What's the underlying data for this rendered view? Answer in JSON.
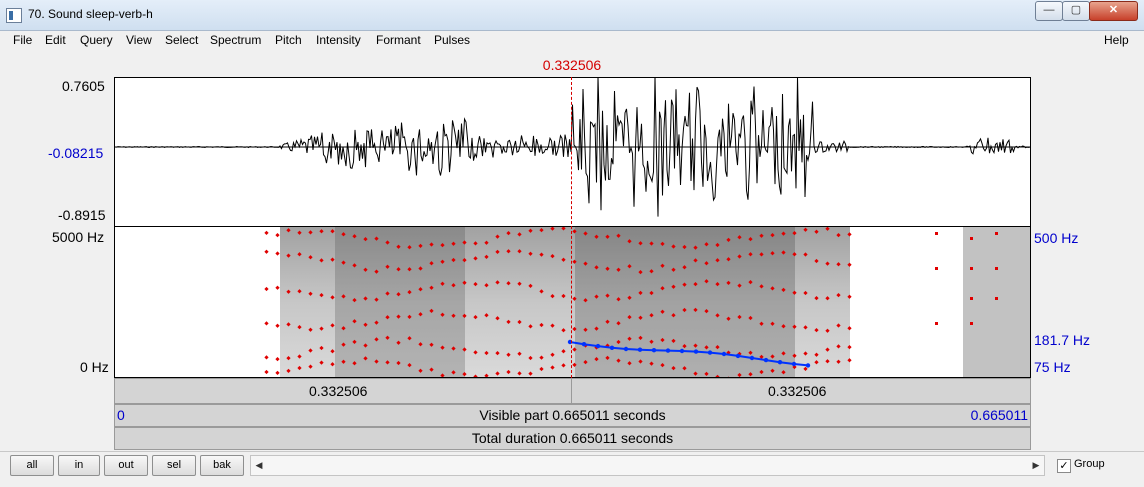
{
  "window": {
    "title": "70. Sound sleep-verb-h",
    "btn_min": "—",
    "btn_max": "▢",
    "btn_close": "✕"
  },
  "menu": {
    "items": [
      "File",
      "Edit",
      "Query",
      "View",
      "Select",
      "Spectrum",
      "Pitch",
      "Intensity",
      "Formant",
      "Pulses"
    ],
    "help": "Help"
  },
  "cursor_time_top": "0.332506",
  "waveform": {
    "ymax": "0.7605",
    "ycursor": "-0.08215",
    "ymin": "-0.8915"
  },
  "spectrogram": {
    "ytop_left": "5000 Hz",
    "ybottom_left": "0 Hz",
    "ytop_right": "500 Hz",
    "ymid_right": "181.7 Hz",
    "ybottom_right": "75 Hz"
  },
  "bars": {
    "left_segment": "0.332506",
    "right_segment": "0.332506",
    "visible_start": "0",
    "visible_text": "Visible part 0.665011 seconds",
    "visible_end": "0.665011",
    "total_text": "Total duration 0.665011 seconds"
  },
  "bottom": {
    "all": "all",
    "in": "in",
    "out": "out",
    "sel": "sel",
    "bak": "bak",
    "scroll_left": "◀",
    "scroll_right": "▶",
    "group_check": "✓",
    "group_label": "Group"
  },
  "colors": {
    "cursor": "#d40000",
    "pitch": "#0033ff",
    "formant": "#e00000",
    "axis_blue": "#0000cc"
  }
}
